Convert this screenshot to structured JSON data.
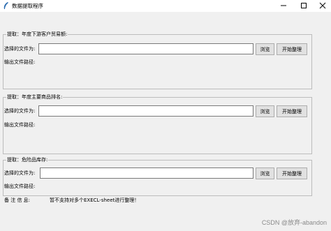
{
  "window": {
    "title": "数据提取程序",
    "icon": "feather-icon",
    "minimize_icon": "minimize-icon",
    "maximize_icon": "maximize-icon",
    "close_icon": "close-icon"
  },
  "sections": [
    {
      "title": "提取：年度下游客户贸易额:",
      "file_label": "选择的文件为:",
      "file_value": "",
      "output_label": "输出文件路径:",
      "browse_label": "浏览",
      "start_label": "开始整理"
    },
    {
      "title": "提取：年度主要商品排名:",
      "file_label": "选择的文件为:",
      "file_value": "",
      "output_label": "输出文件路径:",
      "browse_label": "浏览",
      "start_label": "开始整理"
    },
    {
      "title": "提取：危险品库存:",
      "file_label": "选择的文件为:",
      "file_value": "",
      "output_label": "输出文件路径:",
      "browse_label": "浏览",
      "start_label": "开始整理"
    }
  ],
  "footer": {
    "note_label": "备  注  信  息:",
    "note_text": "暂不支持对多个EXECL-sheet进行整理！"
  },
  "watermark": "CSDN @放弃-abandon"
}
